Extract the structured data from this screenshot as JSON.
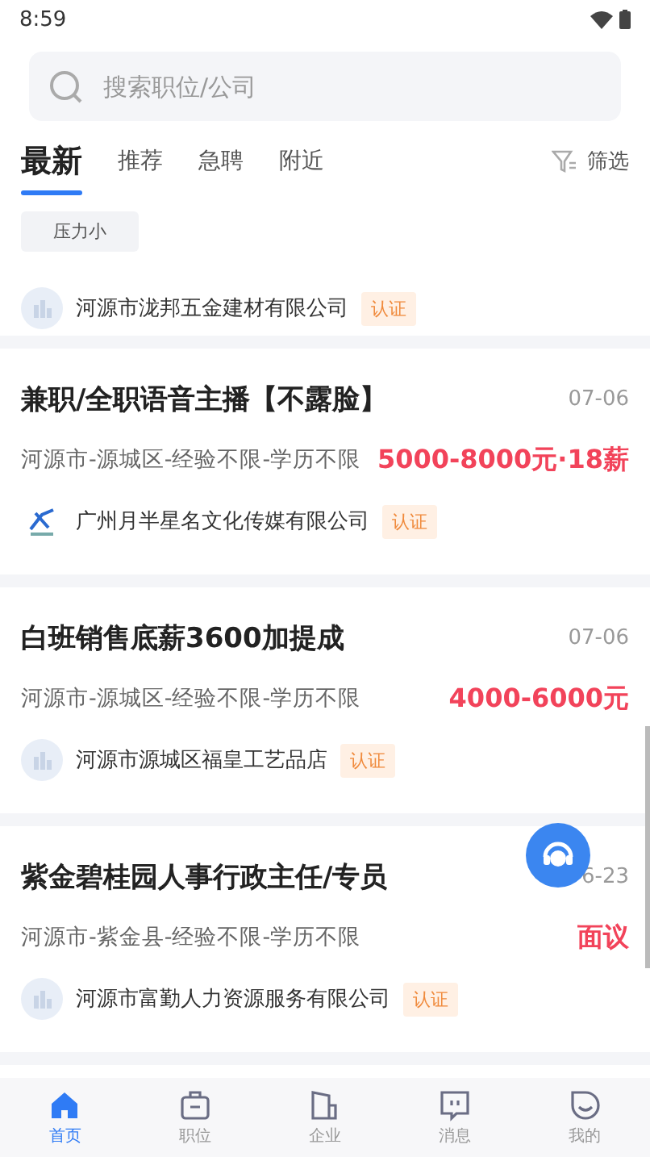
{
  "status_bar": {
    "time": "8:59"
  },
  "search": {
    "placeholder": "搜索职位/公司"
  },
  "tabs": [
    {
      "label": "最新",
      "selected": true
    },
    {
      "label": "推荐",
      "selected": false
    },
    {
      "label": "急聘",
      "selected": false
    },
    {
      "label": "附近",
      "selected": false
    }
  ],
  "filter": {
    "label": "筛选"
  },
  "partial_job": {
    "tags": [
      "压力小"
    ],
    "company": "河源市泷邦五金建材有限公司",
    "badge": "认证"
  },
  "jobs": [
    {
      "title": "兼职/全职语音主播【不露脸】",
      "date": "07-06",
      "meta": "河源市-源城区-经验不限-学历不限",
      "salary": "5000-8000元·18薪",
      "company": "广州月半星名文化传媒有限公司",
      "badge": "认证",
      "kind": "brand"
    },
    {
      "title": "白班销售底薪3600加提成",
      "date": "07-06",
      "meta": "河源市-源城区-经验不限-学历不限",
      "salary": "4000-6000元",
      "company": "河源市源城区福皇工艺品店",
      "badge": "认证",
      "kind": "default"
    },
    {
      "title": "紫金碧桂园人事行政主任/专员",
      "date": "6-23",
      "meta": "河源市-紫金县-经验不限-学历不限",
      "salary": "面议",
      "company": "河源市富勤人力资源服务有限公司",
      "badge": "认证",
      "kind": "default"
    }
  ],
  "bottom_nav": [
    {
      "label": "首页",
      "selected": true
    },
    {
      "label": "职位",
      "selected": false
    },
    {
      "label": "企业",
      "selected": false
    },
    {
      "label": "消息",
      "selected": false
    },
    {
      "label": "我的",
      "selected": false
    }
  ]
}
